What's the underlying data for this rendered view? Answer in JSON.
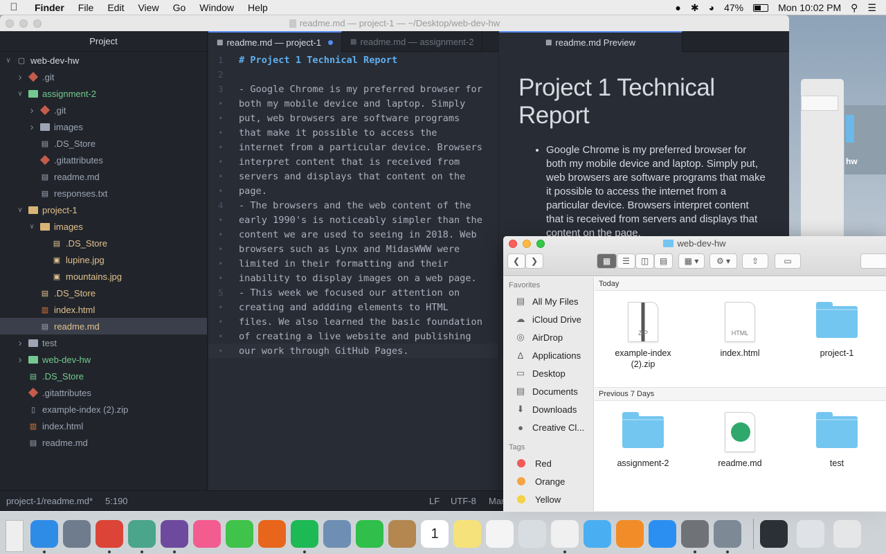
{
  "menubar": {
    "app_name": "Finder",
    "menus": [
      "File",
      "Edit",
      "View",
      "Go",
      "Window",
      "Help"
    ],
    "battery": "47%",
    "clock": "Mon 10:02 PM"
  },
  "atom": {
    "window_title": "readme.md — project-1 — ~/Desktop/web-dev-hw",
    "tree_header": "Project",
    "tree": [
      {
        "label": "web-dev-hw",
        "depth": 0,
        "chev": "v",
        "icon": "repo-icon"
      },
      {
        "label": ".git",
        "depth": 1,
        "chev": ">",
        "icon": "git-icon"
      },
      {
        "label": "assignment-2",
        "depth": 1,
        "chev": "v",
        "icon": "folder-icon",
        "color": "green"
      },
      {
        "label": ".git",
        "depth": 2,
        "chev": ">",
        "icon": "git-icon"
      },
      {
        "label": "images",
        "depth": 2,
        "chev": ">",
        "icon": "folder-icon"
      },
      {
        "label": ".DS_Store",
        "depth": 2,
        "chev": "",
        "icon": "file-icon"
      },
      {
        "label": ".gitattributes",
        "depth": 2,
        "chev": "",
        "icon": "git-icon"
      },
      {
        "label": "readme.md",
        "depth": 2,
        "chev": "",
        "icon": "book-icon"
      },
      {
        "label": "responses.txt",
        "depth": 2,
        "chev": "",
        "icon": "text-icon"
      },
      {
        "label": "project-1",
        "depth": 1,
        "chev": "v",
        "icon": "folder-icon",
        "color": "orange"
      },
      {
        "label": "images",
        "depth": 2,
        "chev": "v",
        "icon": "folder-icon",
        "color": "orange"
      },
      {
        "label": ".DS_Store",
        "depth": 3,
        "chev": "",
        "icon": "file-icon",
        "color": "orange"
      },
      {
        "label": "lupine.jpg",
        "depth": 3,
        "chev": "",
        "icon": "image-icon",
        "color": "orange"
      },
      {
        "label": "mountains.jpg",
        "depth": 3,
        "chev": "",
        "icon": "image-icon",
        "color": "orange"
      },
      {
        "label": ".DS_Store",
        "depth": 2,
        "chev": "",
        "icon": "file-icon",
        "color": "orange"
      },
      {
        "label": "index.html",
        "depth": 2,
        "chev": "",
        "icon": "html-icon",
        "color": "orange"
      },
      {
        "label": "readme.md",
        "depth": 2,
        "chev": "",
        "icon": "book-icon",
        "color": "orange",
        "selected": true
      },
      {
        "label": "test",
        "depth": 1,
        "chev": ">",
        "icon": "folder-icon"
      },
      {
        "label": "web-dev-hw",
        "depth": 1,
        "chev": ">",
        "icon": "folder-icon",
        "color": "green"
      },
      {
        "label": ".DS_Store",
        "depth": 1,
        "chev": "",
        "icon": "file-icon",
        "color": "green"
      },
      {
        "label": ".gitattributes",
        "depth": 1,
        "chev": "",
        "icon": "git-icon"
      },
      {
        "label": "example-index (2).zip",
        "depth": 1,
        "chev": "",
        "icon": "zip-icon"
      },
      {
        "label": "index.html",
        "depth": 1,
        "chev": "",
        "icon": "html-icon"
      },
      {
        "label": "readme.md",
        "depth": 1,
        "chev": "",
        "icon": "book-icon"
      }
    ],
    "tabs": [
      {
        "label": "readme.md — project-1",
        "active": true,
        "modified": true
      },
      {
        "label": "readme.md — assignment-2",
        "active": false,
        "modified": false
      }
    ],
    "preview_tab": "readme.md Preview",
    "code_lines": [
      {
        "num": "1",
        "text": "# Project 1 Technical Report",
        "heading": true
      },
      {
        "num": "2",
        "text": ""
      },
      {
        "num": "3",
        "text": "- Google Chrome is my preferred browser for"
      },
      {
        "num": "•",
        "text": "both my mobile device and laptop. Simply"
      },
      {
        "num": "•",
        "text": "put, web browsers are software programs"
      },
      {
        "num": "•",
        "text": "that make it possible to access the"
      },
      {
        "num": "•",
        "text": "internet from a particular device. Browsers"
      },
      {
        "num": "•",
        "text": "interpret content that is received from"
      },
      {
        "num": "•",
        "text": "servers and displays that content on the"
      },
      {
        "num": "•",
        "text": "page."
      },
      {
        "num": "4",
        "text": "- The browsers and the web content of the"
      },
      {
        "num": "•",
        "text": "early 1990's is noticeably simpler than the"
      },
      {
        "num": "•",
        "text": "content we are used to seeing in 2018. Web"
      },
      {
        "num": "•",
        "text": "browsers such as Lynx and MidasWWW were"
      },
      {
        "num": "•",
        "text": "limited in their formatting and their"
      },
      {
        "num": "•",
        "text": "inability to display images on a web page."
      },
      {
        "num": "5",
        "text": "- This week we focused our attention on"
      },
      {
        "num": "•",
        "text": "creating and addding elements to HTML"
      },
      {
        "num": "•",
        "text": "files. We also learned the basic foundation"
      },
      {
        "num": "•",
        "text": "of creating a live website and publishing"
      },
      {
        "num": "•",
        "text": "our work through GitHub Pages.",
        "current": true
      }
    ],
    "preview": {
      "heading": "Project 1 Technical Report",
      "bullet": "Google Chrome is my preferred browser for both my mobile device and laptop. Simply put, web browsers are software programs that make it possible to access the internet from a particular device. Browsers interpret content that is received from servers and displays that content on the page."
    },
    "status": {
      "path": "project-1/readme.md*",
      "cursor": "5:190",
      "line_ending": "LF",
      "encoding": "UTF-8",
      "grammar": "Mar"
    }
  },
  "background_window": {
    "partial_label": "hw"
  },
  "finder": {
    "title": "web-dev-hw",
    "sidebar": {
      "favorites_label": "Favorites",
      "favorites": [
        {
          "label": "All My Files",
          "icon": "all-files-icon"
        },
        {
          "label": "iCloud Drive",
          "icon": "cloud-icon"
        },
        {
          "label": "AirDrop",
          "icon": "airdrop-icon"
        },
        {
          "label": "Applications",
          "icon": "applications-icon"
        },
        {
          "label": "Desktop",
          "icon": "desktop-icon"
        },
        {
          "label": "Documents",
          "icon": "documents-icon"
        },
        {
          "label": "Downloads",
          "icon": "downloads-icon"
        },
        {
          "label": "Creative Cl...",
          "icon": "creative-cloud-icon"
        }
      ],
      "tags_label": "Tags",
      "tags": [
        {
          "label": "Red",
          "color": "#f25a5a"
        },
        {
          "label": "Orange",
          "color": "#f5a445"
        },
        {
          "label": "Yellow",
          "color": "#f5d245"
        }
      ]
    },
    "sections": [
      {
        "label": "Today",
        "items": [
          {
            "label": "example-index (2).zip",
            "kind": "zip",
            "badge": "ZIP"
          },
          {
            "label": "index.html",
            "kind": "doc",
            "badge": "HTML"
          },
          {
            "label": "project-1",
            "kind": "folder"
          }
        ]
      },
      {
        "label": "Previous 7 Days",
        "items": [
          {
            "label": "assignment-2",
            "kind": "folder"
          },
          {
            "label": "readme.md",
            "kind": "atom"
          },
          {
            "label": "test",
            "kind": "folder"
          }
        ]
      }
    ]
  },
  "dock": {
    "apps": [
      {
        "name": "finder-icon",
        "color": "#2f8ce6",
        "dot": true
      },
      {
        "name": "launchpad-icon",
        "color": "#6f7c8e",
        "dot": false
      },
      {
        "name": "chrome-icon",
        "color": "#db4437",
        "dot": true
      },
      {
        "name": "atom-icon",
        "color": "#4aa58a",
        "dot": true
      },
      {
        "name": "github-desktop-icon",
        "color": "#6e4a9e",
        "dot": true
      },
      {
        "name": "itunes-icon",
        "color": "#f25c8f",
        "dot": false
      },
      {
        "name": "messages-green-icon",
        "color": "#3fc34a",
        "dot": false
      },
      {
        "name": "firefox-icon",
        "color": "#e8661b",
        "dot": false
      },
      {
        "name": "spotify-icon",
        "color": "#1db954",
        "dot": true
      },
      {
        "name": "preview-icon",
        "color": "#6e8fb3",
        "dot": false
      },
      {
        "name": "facetime-icon",
        "color": "#2fbf4a",
        "dot": false
      },
      {
        "name": "contacts-icon",
        "color": "#b48650",
        "dot": false
      },
      {
        "name": "calendar-icon",
        "color": "#ffffff",
        "dot": false,
        "text": "1"
      },
      {
        "name": "notes-icon",
        "color": "#f6e27a",
        "dot": false
      },
      {
        "name": "reminders-icon",
        "color": "#f4f4f4",
        "dot": false
      },
      {
        "name": "photo-booth-icon",
        "color": "#d8dde2",
        "dot": false
      },
      {
        "name": "photos-icon",
        "color": "#f0f0f0",
        "dot": true
      },
      {
        "name": "messages-icon",
        "color": "#4aaef2",
        "dot": false
      },
      {
        "name": "ibooks-icon",
        "color": "#f28c28",
        "dot": false
      },
      {
        "name": "app-store-icon",
        "color": "#2b8ff2",
        "dot": false
      },
      {
        "name": "system-preferences-icon",
        "color": "#6f7277",
        "dot": true
      },
      {
        "name": "image-capture-icon",
        "color": "#7d8a96",
        "dot": true
      },
      {
        "name": "terminal-window-icon",
        "color": "#2b2f36",
        "dot": false
      },
      {
        "name": "screenshot-window-icon",
        "color": "#dfe3e8",
        "dot": false
      },
      {
        "name": "trash-icon",
        "color": "#e4e6e8",
        "dot": false
      }
    ]
  }
}
